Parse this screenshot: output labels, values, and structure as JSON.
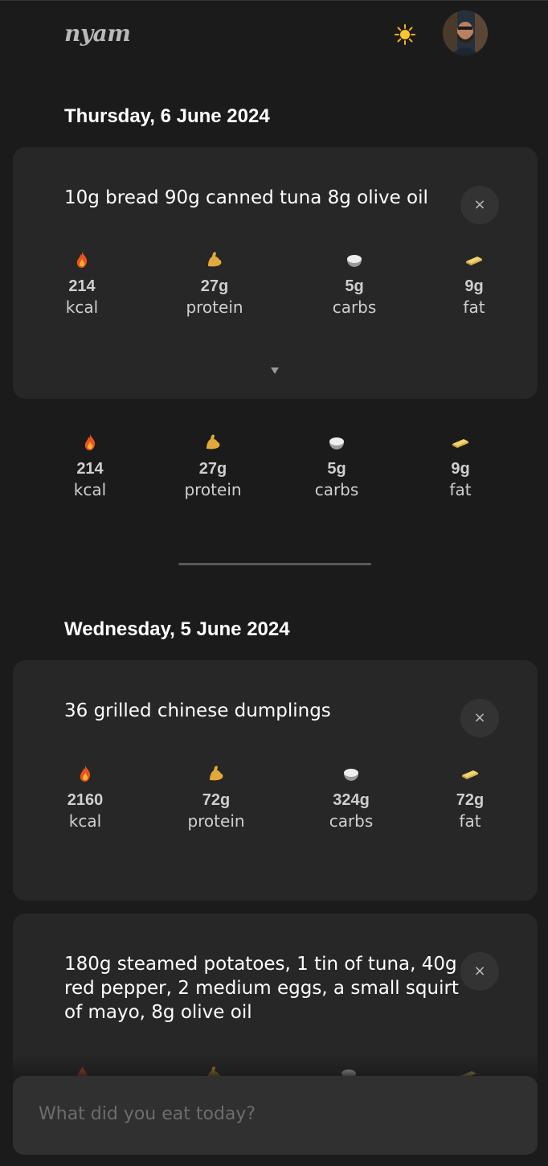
{
  "header": {
    "logo": "nyam",
    "theme_icon": "sun-icon",
    "avatar_icon": "user-avatar"
  },
  "days": [
    {
      "date": "Thursday, 6 June 2024",
      "entries": [
        {
          "title": "10g bread 90g canned tuna 8g olive oil",
          "close_label": "×",
          "macros": {
            "kcal": "214",
            "protein": "27g",
            "carbs": "5g",
            "fat": "9g"
          }
        }
      ],
      "total": {
        "kcal": "214",
        "protein": "27g",
        "carbs": "5g",
        "fat": "9g"
      }
    },
    {
      "date": "Wednesday, 5 June 2024",
      "entries": [
        {
          "title": "36 grilled chinese dumplings",
          "close_label": "×",
          "macros": {
            "kcal": "2160",
            "protein": "72g",
            "carbs": "324g",
            "fat": "72g"
          }
        },
        {
          "title": "180g steamed potatoes, 1 tin of tuna, 40g red pepper, 2 medium eggs, a small squirt of mayo, 8g olive oil",
          "close_label": "×"
        }
      ]
    }
  ],
  "labels": {
    "kcal": "kcal",
    "protein": "protein",
    "carbs": "carbs",
    "fat": "fat"
  },
  "icons": {
    "kcal": "fire-icon",
    "protein": "flexed-bicep-icon",
    "carbs": "rice-bowl-icon",
    "fat": "butter-icon"
  },
  "input": {
    "placeholder": "What did you eat today?"
  },
  "colors": {
    "background": "#1b1b1b",
    "card": "#272727",
    "input": "#303030"
  }
}
